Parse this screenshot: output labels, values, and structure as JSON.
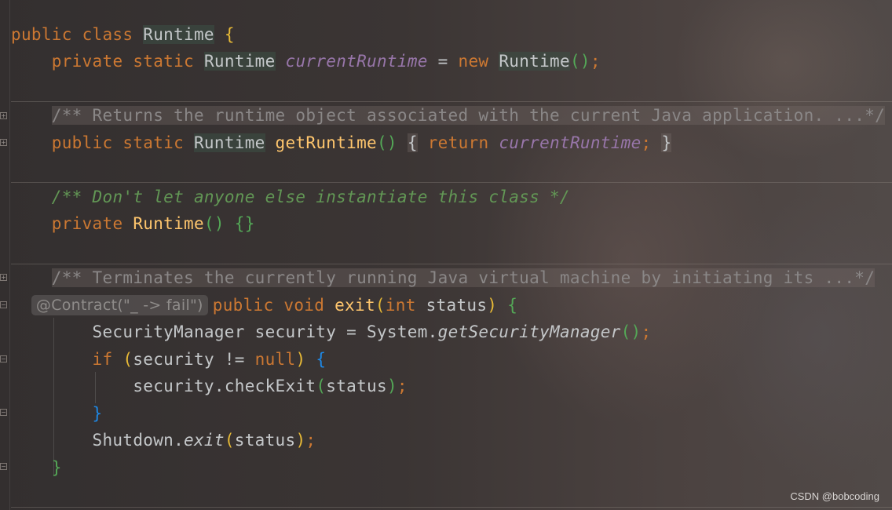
{
  "code": {
    "l1": {
      "kw": "public class ",
      "cls": "Runtime",
      "brace": "{"
    },
    "l2": {
      "kw1": "private static ",
      "type": "Runtime",
      "field": "currentRuntime",
      "op": " = ",
      "kw2": "new ",
      "ctor": "Runtime",
      "paren": "()",
      "semi": ";"
    },
    "l3": {
      "comment": "/** Returns the runtime object associated with the current Java application. ...*/"
    },
    "l4": {
      "kw1": "public static ",
      "type": "Runtime",
      "fn": "getRuntime",
      "paren": "()",
      "box_open": "{",
      "kw2": "return ",
      "field": "currentRuntime",
      "semi": ";",
      "box_close": "}"
    },
    "l5": {
      "doc": "/** Don't let anyone else instantiate this class */"
    },
    "l6": {
      "kw": "private ",
      "fn": "Runtime",
      "paren": "()",
      "braces": "{}"
    },
    "l7": {
      "comment": "/** Terminates the currently running Java virtual machine by initiating its ...*/"
    },
    "l8": {
      "annotation": "@Contract(\"_ -> fail\")",
      "kw1": "public void ",
      "fn": "exit",
      "popen": "(",
      "kw2": "int ",
      "param": "status",
      "pclose": ")",
      "brace": "{"
    },
    "l9": {
      "text1": "SecurityManager security = System.",
      "call": "getSecurityManager",
      "paren": "()",
      "semi": ";"
    },
    "l10": {
      "kw": "if ",
      "popen": "(",
      "text": "security != ",
      "kw2": "null",
      "pclose": ")",
      "brace": "{"
    },
    "l11": {
      "text": "security.checkExit",
      "popen": "(",
      "arg": "status",
      "pclose": ")",
      "semi": ";"
    },
    "l12": {
      "brace": "}"
    },
    "l13": {
      "text": "Shutdown.",
      "call": "exit",
      "popen": "(",
      "arg": "status",
      "pclose": ")",
      "semi": ";"
    },
    "l14": {
      "brace": "}"
    }
  },
  "watermark": "CSDN @bobcoding",
  "colors": {
    "keyword": "#cc7832",
    "function": "#ffc66d",
    "field": "#9876aa",
    "doc_comment": "#629755",
    "comment": "#8a8787",
    "text": "#c4c7c9"
  }
}
